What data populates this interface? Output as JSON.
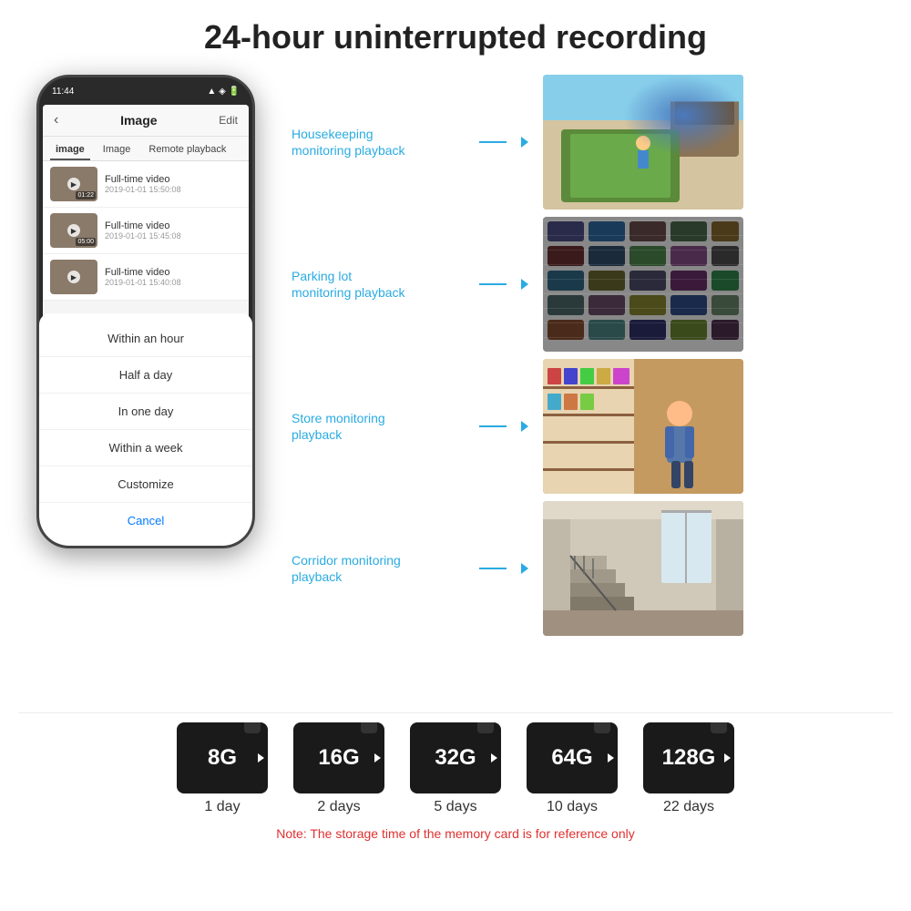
{
  "title": "24-hour uninterrupted recording",
  "phone": {
    "time": "11:44",
    "nav_title": "Image",
    "nav_back": "‹",
    "nav_edit": "Edit",
    "tab_image": "image",
    "tab_image2": "Image",
    "tab_remote": "Remote playback",
    "videos": [
      {
        "title": "Full-time video",
        "date": "2019-01-01 15:50:08",
        "duration": "01:22"
      },
      {
        "title": "Full-time video",
        "date": "2019-01-01 15:45:08",
        "duration": "05:00"
      },
      {
        "title": "Full-time video",
        "date": "2019-01-01 15:40:08",
        "duration": ""
      }
    ],
    "dropdown_items": [
      "Within an hour",
      "Half a day",
      "In one day",
      "Within a week",
      "Customize"
    ],
    "cancel_label": "Cancel"
  },
  "monitoring": [
    {
      "label": "Housekeeping\nmonitoring playback",
      "scene": "housekeeping"
    },
    {
      "label": "Parking lot\nmonitoring playback",
      "scene": "parking"
    },
    {
      "label": "Store monitoring\nplayback",
      "scene": "store"
    },
    {
      "label": "Corridor monitoring\nplayback",
      "scene": "corridor"
    }
  ],
  "sd_cards": [
    {
      "size": "8G",
      "days": "1 day"
    },
    {
      "size": "16G",
      "days": "2 days"
    },
    {
      "size": "32G",
      "days": "5 days"
    },
    {
      "size": "64G",
      "days": "10 days"
    },
    {
      "size": "128G",
      "days": "22 days"
    }
  ],
  "note": "Note: The storage time of the memory card is for reference only"
}
